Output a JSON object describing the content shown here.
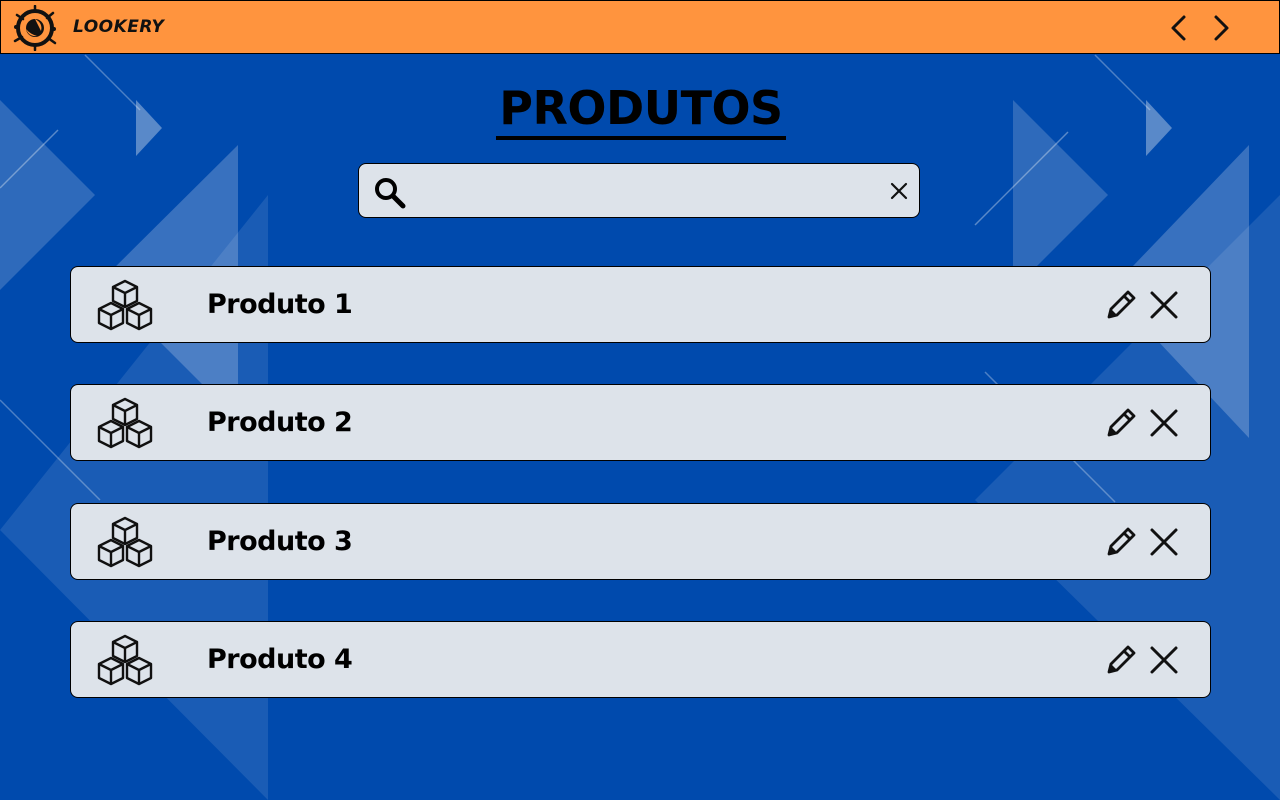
{
  "app": {
    "brand": "LOOKERY",
    "background_color": "#004aad",
    "topbar_color": "#ff943e"
  },
  "nav": {
    "prev_icon": "chevron-left-icon",
    "next_icon": "chevron-right-icon"
  },
  "page": {
    "title": "PRODUTOS"
  },
  "search": {
    "value": "",
    "placeholder": "",
    "icon": "search-icon",
    "clear_icon": "close-icon"
  },
  "products": [
    {
      "name": "Produto 1",
      "icon": "boxes-icon",
      "edit_icon": "pencil-icon",
      "delete_icon": "close-icon"
    },
    {
      "name": "Produto 2",
      "icon": "boxes-icon",
      "edit_icon": "pencil-icon",
      "delete_icon": "close-icon"
    },
    {
      "name": "Produto 3",
      "icon": "boxes-icon",
      "edit_icon": "pencil-icon",
      "delete_icon": "close-icon"
    },
    {
      "name": "Produto 4",
      "icon": "boxes-icon",
      "edit_icon": "pencil-icon",
      "delete_icon": "close-icon"
    }
  ]
}
